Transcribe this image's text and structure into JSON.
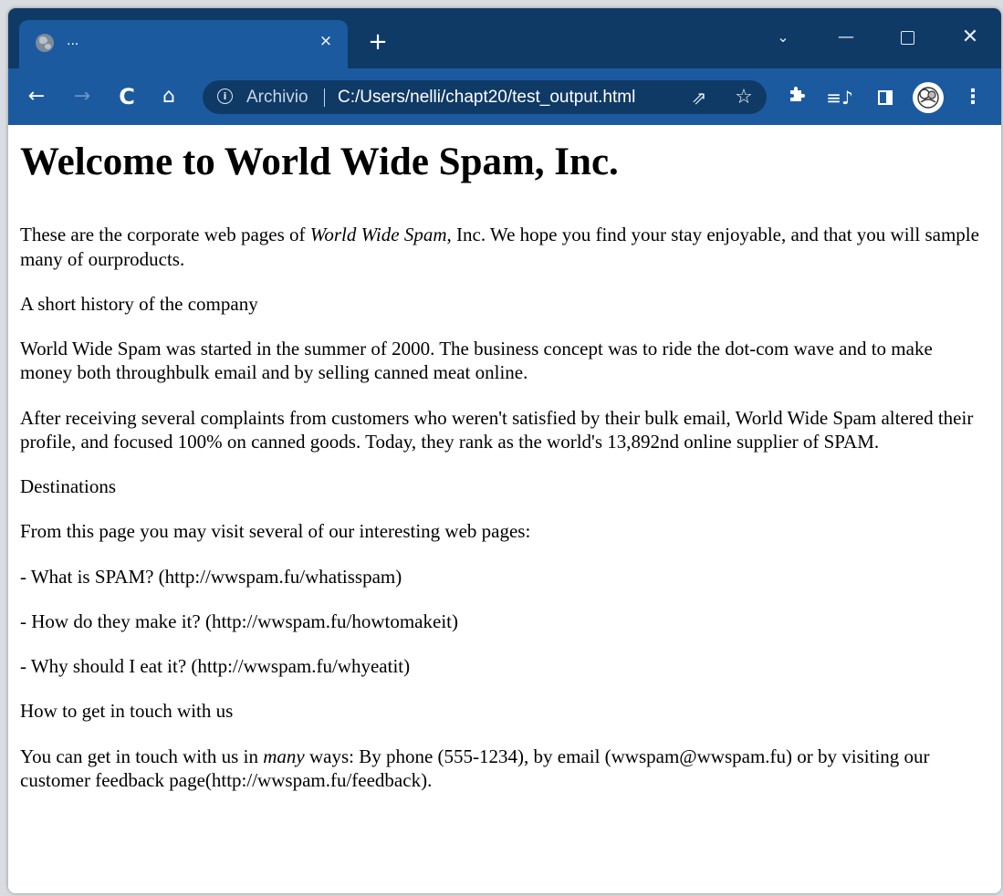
{
  "browser": {
    "tab": {
      "title": "...",
      "close_glyph": "×"
    },
    "new_tab_glyph": "+",
    "window_controls": {
      "tab_search": "⌄",
      "minimize": "—",
      "close": "✕"
    },
    "nav": {
      "back": "←",
      "forward": "→",
      "reload": "C",
      "home": "⌂"
    },
    "omnibox": {
      "label": "Archivio",
      "url": "C:/Users/nelli/chapt20/test_output.html",
      "share_icon": "⇗",
      "bookmark_icon": "☆"
    },
    "toolbar_icons": {
      "extensions": "puzzle-icon",
      "media": "≡♪",
      "menu": "⋮"
    }
  },
  "page": {
    "heading": "Welcome to World Wide Spam, Inc.",
    "intro": {
      "before": "These are the corporate web pages of ",
      "emphasis": "World Wide Spam",
      "after": ", Inc. We hope you find your stay enjoyable, and that you will sample many of ourproducts."
    },
    "history_heading": "A short history of the company",
    "history_p1": "World Wide Spam was started in the summer of 2000. The business concept was to ride the dot-com wave and to make money both throughbulk email and by selling canned meat online.",
    "history_p2": "After receiving several complaints from customers who weren't satisfied by their bulk email, World Wide Spam altered their profile, and focused 100% on canned goods. Today, they rank as the world's 13,892nd online supplier of SPAM.",
    "destinations_heading": "Destinations",
    "destinations_intro": "From this page you may visit several of our interesting web pages:",
    "links": [
      "- What is SPAM? (http://wwspam.fu/whatisspam)",
      "- How do they make it? (http://wwspam.fu/howtomakeit)",
      "- Why should I eat it? (http://wwspam.fu/whyeatit)"
    ],
    "contact_heading": "How to get in touch with us",
    "contact": {
      "before": "You can get in touch with us in ",
      "emphasis": "many",
      "after": " ways: By phone (555-1234), by email (wwspam@wwspam.fu) or by visiting our customer feedback page(http://wwspam.fu/feedback)."
    }
  },
  "colors": {
    "titlebar": "#0f3a66",
    "toolbar": "#1c5aa0",
    "omnibox": "#0f3a66"
  }
}
